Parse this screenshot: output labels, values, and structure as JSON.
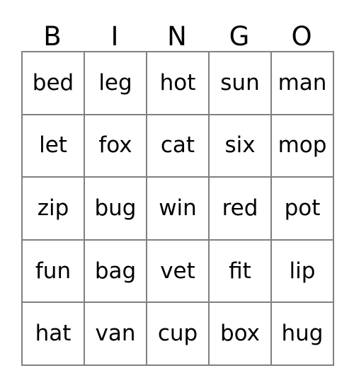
{
  "card": {
    "title": "BINGO",
    "headers": [
      "B",
      "I",
      "N",
      "G",
      "O"
    ],
    "grid_size": "5x5",
    "colors": {
      "background": "#ffffff",
      "text": "#000000",
      "border": "#808080"
    },
    "rows": [
      {
        "cells": [
          "bed",
          "leg",
          "hot",
          "sun",
          "man"
        ]
      },
      {
        "cells": [
          "let",
          "fox",
          "cat",
          "six",
          "mop"
        ]
      },
      {
        "cells": [
          "zip",
          "bug",
          "win",
          "red",
          "pot"
        ]
      },
      {
        "cells": [
          "fun",
          "bag",
          "vet",
          "fit",
          "lip"
        ]
      },
      {
        "cells": [
          "hat",
          "van",
          "cup",
          "box",
          "hug"
        ]
      }
    ]
  }
}
